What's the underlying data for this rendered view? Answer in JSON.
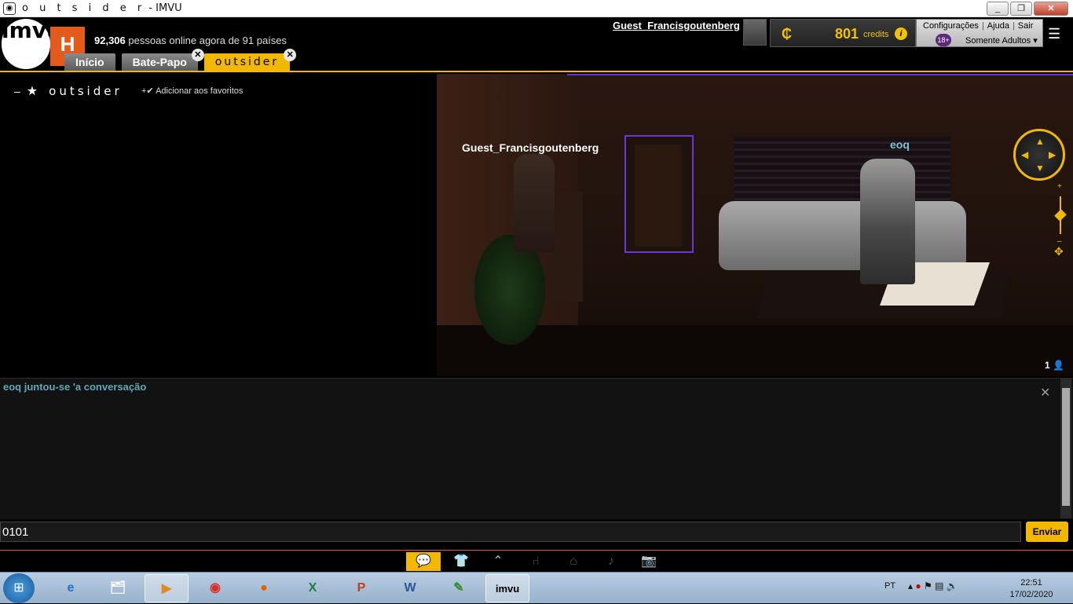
{
  "window": {
    "title_spaced": "o u t s i d e r",
    "title_suffix": " - IMVU",
    "minimize": "_",
    "maximize": "❐",
    "close": "✕"
  },
  "header": {
    "logo_text": "imvu",
    "home_badge": "H",
    "online_count": "92,306",
    "online_text": " pessoas online agora de 91 países",
    "username": "Guest_Francisgoutenberg",
    "credits_amount": "801",
    "credits_label": "credits",
    "credits_info": "i",
    "links": [
      "Configurações",
      "Ajuda",
      "Sair"
    ],
    "adult_badge": "18+",
    "adult_label": "Somente Adultos"
  },
  "tabs": [
    {
      "label": "Início",
      "closable": false
    },
    {
      "label": "Bate-Papo",
      "closable": true
    },
    {
      "label": "outsider",
      "closable": true,
      "active": true
    }
  ],
  "room": {
    "dash": "–",
    "star": "★",
    "name": "outsider",
    "add_favorite": "+✔ Adicionar aos favoritos",
    "avatars": [
      {
        "name": "Guest_Francisgoutenberg",
        "color": "#ffffff"
      },
      {
        "name": "eoq",
        "color": "#7fc4d8"
      }
    ],
    "people_count": "1"
  },
  "chat": {
    "messages": [
      "eoq juntou-se 'a conversação"
    ],
    "close": "✕",
    "input_value": "0101",
    "send_label": "Enviar"
  },
  "toolbar": {
    "icons": [
      "chat-icon",
      "shirt-icon",
      "hanger-icon",
      "chair-icon",
      "home-icon",
      "music-icon",
      "camera-icon"
    ]
  },
  "taskbar": {
    "apps": [
      "ie",
      "explorer",
      "media",
      "chrome",
      "firefox",
      "excel",
      "powerpoint",
      "word",
      "notepad",
      "imvu"
    ],
    "lang": "PT",
    "time": "22:51",
    "date": "17/02/2020"
  },
  "colors": {
    "accent": "#f2b800",
    "brand_orange": "#e35a1c",
    "chat_text": "#5fa8b8",
    "neon": "#6a35d9"
  }
}
